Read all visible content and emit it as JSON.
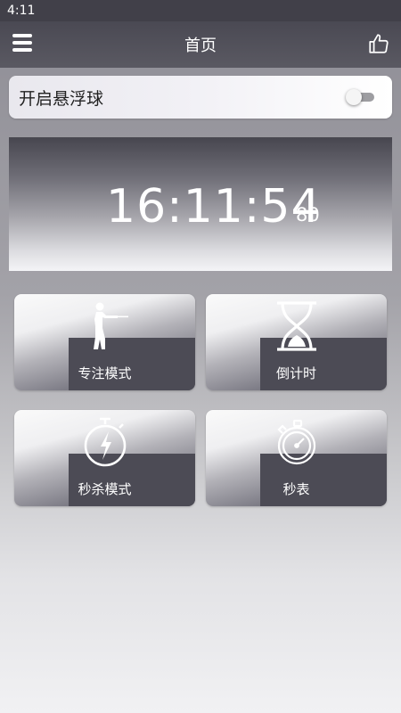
{
  "status_bar": {
    "time": "4:11"
  },
  "header": {
    "title": "首页"
  },
  "float_ball": {
    "label": "开启悬浮球",
    "enabled": false
  },
  "clock": {
    "time": "16:11:54",
    "milliseconds": "80"
  },
  "tiles": [
    {
      "label": "专注模式",
      "icon": "shooter-icon"
    },
    {
      "label": "倒计时",
      "icon": "hourglass-icon"
    },
    {
      "label": "秒杀模式",
      "icon": "flash-timer-icon"
    },
    {
      "label": "秒表",
      "icon": "stopwatch-icon"
    }
  ]
}
